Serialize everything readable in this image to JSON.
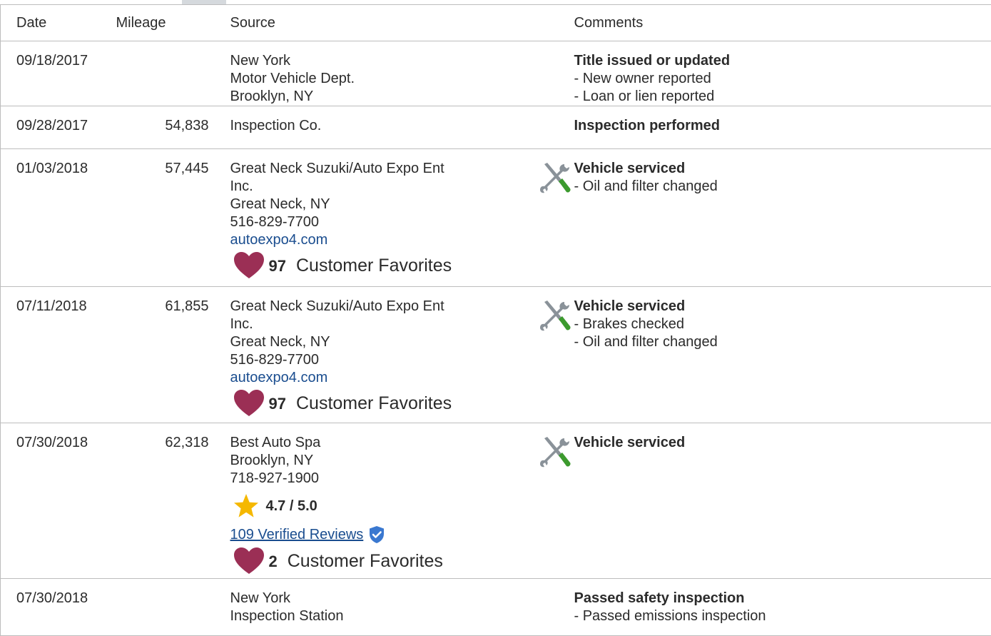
{
  "columns": {
    "date": "Date",
    "mileage": "Mileage",
    "source": "Source",
    "comments": "Comments"
  },
  "rows": [
    {
      "date": "09/18/2017",
      "mileage": "",
      "source": {
        "name": "New York",
        "line2": "Motor Vehicle Dept.",
        "city": "Brooklyn, NY"
      },
      "comments": {
        "headline": "Title issued or updated",
        "details": [
          "- New owner reported",
          "- Loan or lien reported"
        ]
      }
    },
    {
      "date": "09/28/2017",
      "mileage": "54,838",
      "source": {
        "name": "Inspection Co."
      },
      "comments": {
        "headline": "Inspection performed"
      }
    },
    {
      "date": "01/03/2018",
      "mileage": "57,445",
      "source": {
        "name": "Great Neck Suzuki/Auto Expo Ent",
        "line2": "Inc.",
        "city": "Great Neck, NY",
        "phone": "516-829-7700",
        "website": "autoexpo4.com",
        "favorites_count": "97",
        "favorites_label": "Customer Favorites"
      },
      "comments": {
        "icon": "wrench-screwdriver-icon",
        "headline": "Vehicle serviced",
        "details": [
          "- Oil and filter changed"
        ]
      }
    },
    {
      "date": "07/11/2018",
      "mileage": "61,855",
      "source": {
        "name": "Great Neck Suzuki/Auto Expo Ent",
        "line2": "Inc.",
        "city": "Great Neck, NY",
        "phone": "516-829-7700",
        "website": "autoexpo4.com",
        "favorites_count": "97",
        "favorites_label": "Customer Favorites"
      },
      "comments": {
        "icon": "wrench-screwdriver-icon",
        "headline": "Vehicle serviced",
        "details": [
          "- Brakes checked",
          "- Oil and filter changed"
        ]
      }
    },
    {
      "date": "07/30/2018",
      "mileage": "62,318",
      "source": {
        "name": "Best Auto Spa",
        "city": "Brooklyn, NY",
        "phone": "718-927-1900",
        "rating": "4.7 / 5.0",
        "reviews": "109 Verified Reviews",
        "favorites_count": "2",
        "favorites_label": "Customer Favorites"
      },
      "comments": {
        "icon": "wrench-screwdriver-icon",
        "headline": "Vehicle serviced"
      }
    },
    {
      "date": "07/30/2018",
      "mileage": "",
      "source": {
        "name": "New York",
        "line2": "Inspection Station"
      },
      "comments": {
        "headline": "Passed safety inspection",
        "details": [
          "- Passed emissions inspection"
        ]
      }
    }
  ],
  "colors": {
    "link": "#1a4d8f",
    "heart": "#9b2f55",
    "star": "#f5b800",
    "verified": "#3a78d0",
    "tool_handle": "#3c9a2e",
    "tool_metal": "#8a9299"
  }
}
